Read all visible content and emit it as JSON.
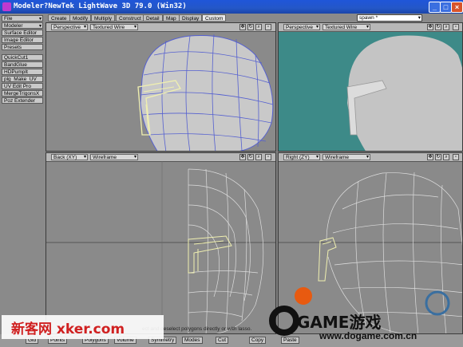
{
  "window": {
    "title": "Modeler?NewTek LightWave 3D 79.0 (Win32)"
  },
  "window_buttons": {
    "minimize": "_",
    "maximize": "□",
    "close": "×"
  },
  "sidebar": {
    "items": [
      {
        "label": "File",
        "dropdown": true
      },
      {
        "label": "Modeler",
        "dropdown": true
      },
      {
        "label": "Surface Editor"
      },
      {
        "label": "Image Editor"
      },
      {
        "label": "Presets"
      },
      {
        "label": "QuickCut1"
      },
      {
        "label": "BandGlue"
      },
      {
        "label": "HDPumpIt"
      },
      {
        "label": "plg_Make_UV_"
      },
      {
        "label": "UV Edit Pro"
      },
      {
        "label": "MergeTrigonsX"
      },
      {
        "label": "Poz Extender"
      }
    ]
  },
  "tabs": [
    {
      "label": "Create"
    },
    {
      "label": "Modify"
    },
    {
      "label": "Multiply"
    },
    {
      "label": "Construct"
    },
    {
      "label": "Detail"
    },
    {
      "label": "Map"
    },
    {
      "label": "Display"
    },
    {
      "label": "Custom",
      "active": true
    }
  ],
  "spawn_select": "spawn *",
  "viewports": [
    {
      "view": "Perspective",
      "axis": "",
      "mode": "Textured Wire"
    },
    {
      "view": "Perspective",
      "axis": "",
      "mode": "Textured Wire"
    },
    {
      "view": "Back",
      "axis": "(XY)",
      "mode": "Wireframe"
    },
    {
      "view": "Right",
      "axis": "(ZY)",
      "mode": "Wireframe"
    }
  ],
  "status_bar": {
    "hint": "ect and deselect polygons directly or with lasso.",
    "buttons": [
      "Gid",
      "Points",
      "Polygons",
      "Volume",
      "Symmetry",
      "Modes",
      "Cut",
      "Copy",
      "Paste"
    ]
  },
  "watermarks": {
    "left": "新客网 xker.com",
    "right_brand": "GAME游戏",
    "right_url": "www.dogame.com.cn"
  },
  "colors": {
    "viewport_bg": "#8a8a8a",
    "persp_bg_right": "#3d8a88",
    "wire": "#5560d0",
    "selection": "#f0f0b0"
  }
}
